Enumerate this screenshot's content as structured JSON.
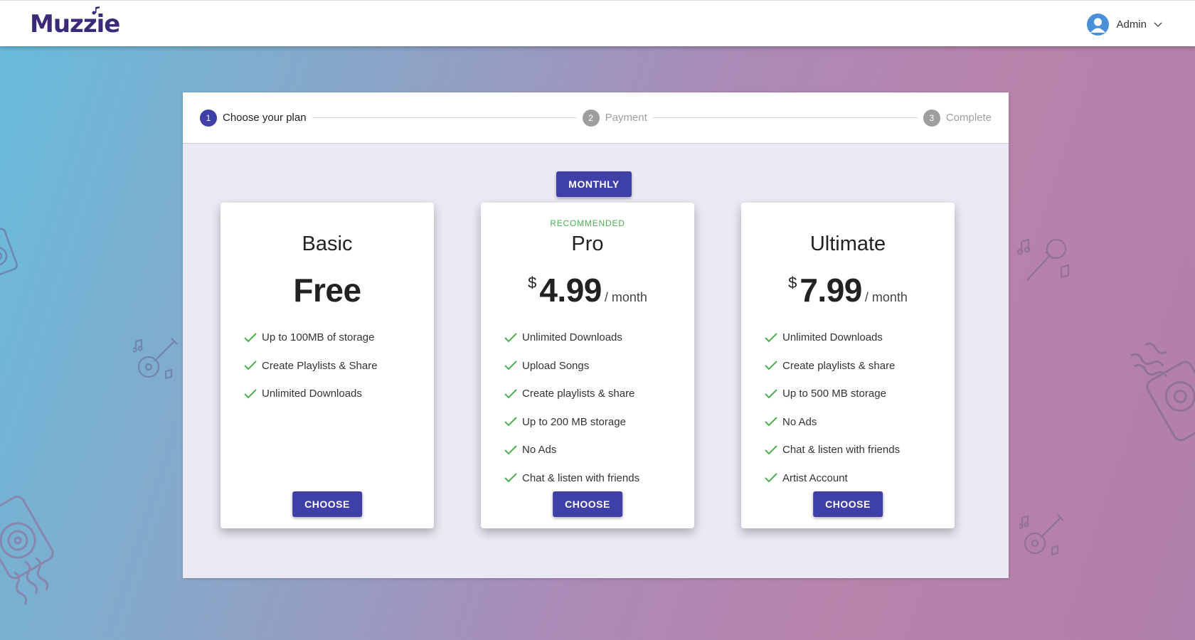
{
  "app": {
    "name": "Muzzie"
  },
  "header": {
    "user_name": "Admin",
    "colors": {
      "brand": "#3b2a78",
      "avatar": "#4a90d9"
    }
  },
  "stepper": {
    "steps": [
      {
        "num": "1",
        "label": "Choose your plan",
        "state": "active"
      },
      {
        "num": "2",
        "label": "Payment",
        "state": "inactive"
      },
      {
        "num": "3",
        "label": "Complete",
        "state": "inactive"
      }
    ]
  },
  "billing_toggle": {
    "label": "MONTHLY"
  },
  "plans": [
    {
      "name": "Basic",
      "badge": "",
      "currency": "",
      "price": "Free",
      "period": "",
      "features": [
        "Up to 100MB of storage",
        "Create Playlists & Share",
        "Unlimited Downloads"
      ],
      "button": "CHOOSE"
    },
    {
      "name": "Pro",
      "badge": "RECOMMENDED",
      "currency": "$",
      "price": "4.99",
      "period": "/ month",
      "features": [
        "Unlimited Downloads",
        "Upload Songs",
        "Create playlists & share",
        "Up to 200 MB storage",
        "No Ads",
        "Chat & listen with friends"
      ],
      "button": "CHOOSE"
    },
    {
      "name": "Ultimate",
      "badge": "",
      "currency": "$",
      "price": "7.99",
      "period": "/ month",
      "features": [
        "Unlimited Downloads",
        "Create playlists & share",
        "Up to 500 MB storage",
        "No Ads",
        "Chat & listen with friends",
        "Artist Account"
      ],
      "button": "CHOOSE"
    }
  ],
  "colors": {
    "primary": "#3f3fa8",
    "check": "#4caf50",
    "recommended": "#4caf50"
  },
  "icons": [
    "check-icon",
    "user-avatar-icon",
    "chevron-down-icon",
    "guitar-icon",
    "microphone-icon",
    "speaker-icon",
    "music-note-icon"
  ]
}
